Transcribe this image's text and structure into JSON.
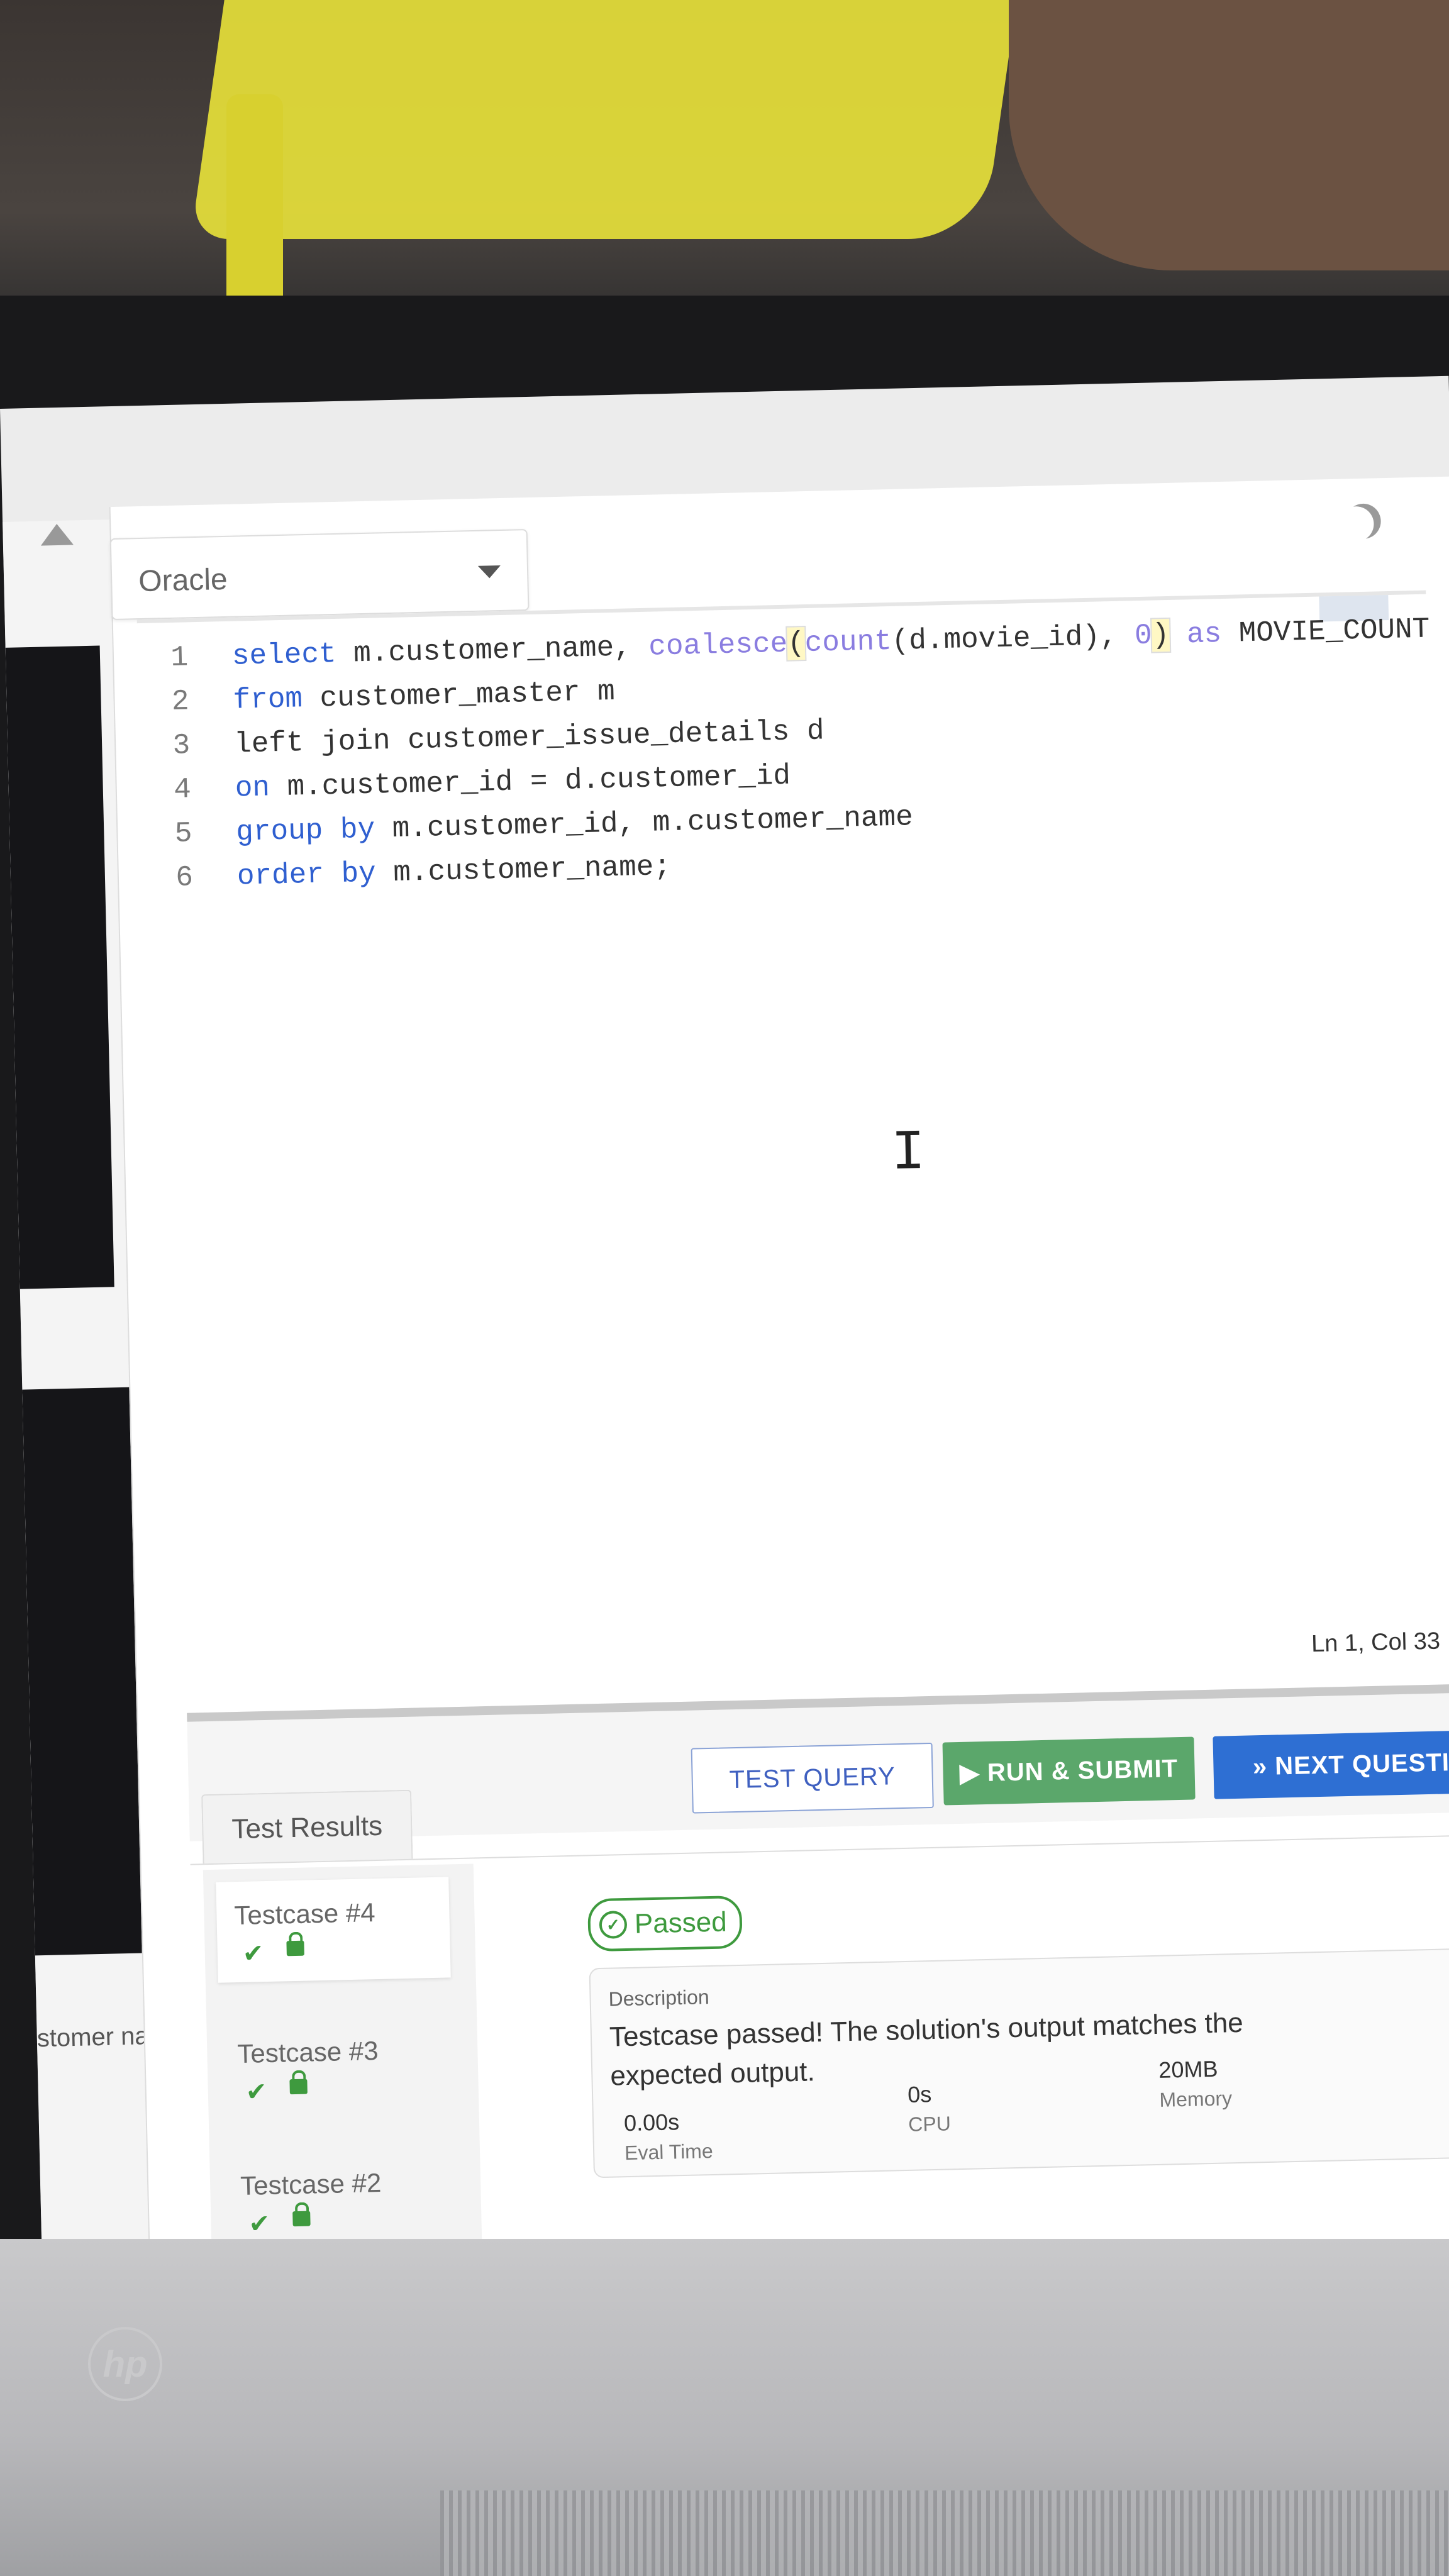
{
  "editor": {
    "language": "Oracle",
    "lines": [
      {
        "n": "1"
      },
      {
        "n": "2"
      },
      {
        "n": "3"
      },
      {
        "n": "4"
      },
      {
        "n": "5"
      },
      {
        "n": "6"
      }
    ],
    "code": {
      "l1": {
        "kw": "select",
        "a": " m.customer_name, ",
        "fn1": "coalesce",
        "p1": "(",
        "fn2": "count",
        "b": "(d.movie_id), ",
        "zero": "0",
        "p2": ")",
        "kw2": " as",
        "c": " MOVIE_COUNT"
      },
      "l2": {
        "kw": "from",
        "a": " customer_master m"
      },
      "l3": {
        "a": "left join customer_issue_details d"
      },
      "l4": {
        "kw": "on",
        "a": " m.customer_id = d.customer_id"
      },
      "l5": {
        "kw": "group by",
        "a": " m.customer_id, m.customer_name"
      },
      "l6": {
        "kw": "order by",
        "a": " m.customer_name;"
      }
    },
    "status": "Ln 1, Col 33"
  },
  "toolbar": {
    "test_query": "TEST QUERY",
    "run_submit": "▶ RUN & SUBMIT",
    "next_question": "» NEXT QUESTIO"
  },
  "results": {
    "tab_label": "Test Results",
    "testcases": [
      {
        "name": "Testcase #4"
      },
      {
        "name": "Testcase #3"
      },
      {
        "name": "Testcase #2"
      }
    ],
    "status": "Passed",
    "description_label": "Description",
    "description": "Testcase passed! The solution's output matches the expected output.",
    "metrics": {
      "eval_time": "0.00s",
      "eval_time_label": "Eval Time",
      "cpu": "0s",
      "cpu_label": "CPU",
      "memory": "20MB",
      "memory_label": "Memory"
    }
  },
  "left_panel": {
    "partial_text": "stomer name in"
  },
  "device": {
    "brand": "hp"
  }
}
